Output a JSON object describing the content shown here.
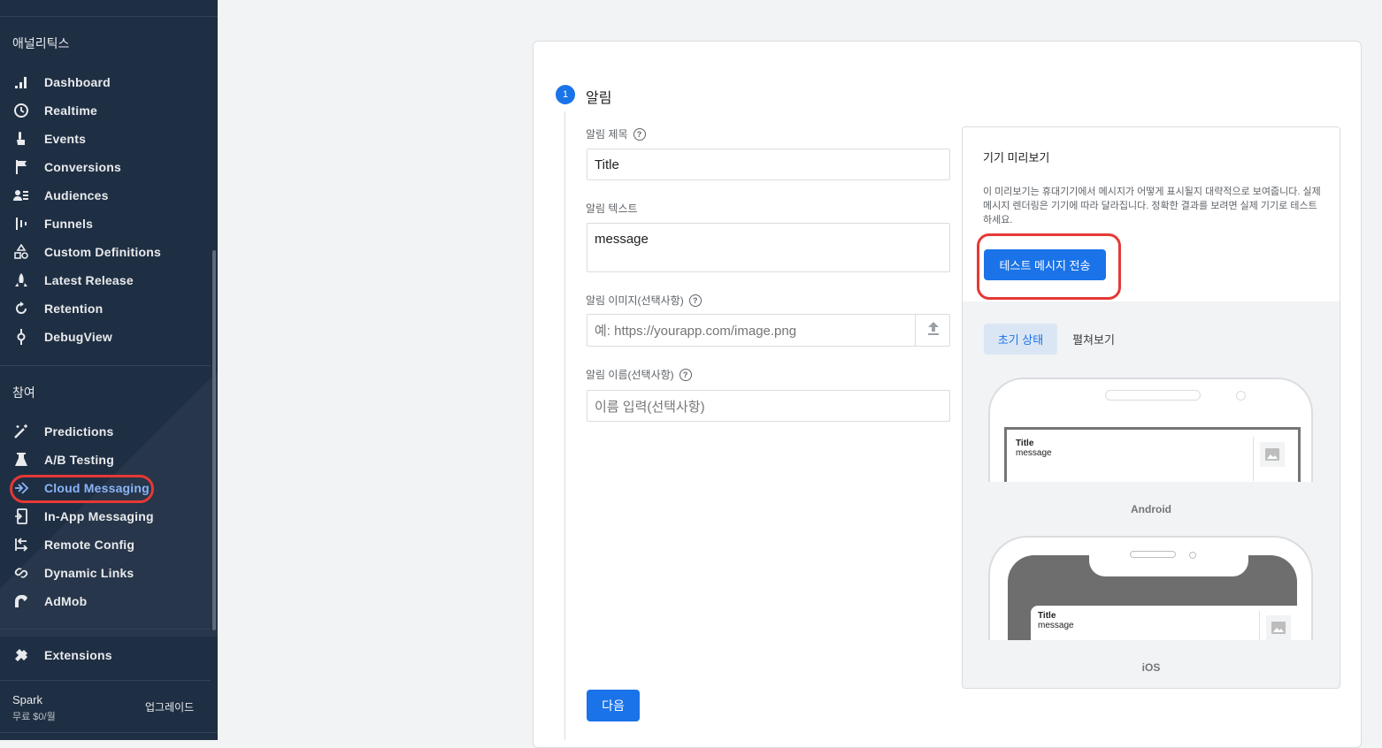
{
  "sidebar": {
    "section_analytics": "애널리틱스",
    "analytics_items": [
      {
        "label": "Dashboard",
        "icon": "bar-chart-icon"
      },
      {
        "label": "Realtime",
        "icon": "clock-icon"
      },
      {
        "label": "Events",
        "icon": "touch-icon"
      },
      {
        "label": "Conversions",
        "icon": "flag-icon"
      },
      {
        "label": "Audiences",
        "icon": "audience-icon"
      },
      {
        "label": "Funnels",
        "icon": "funnel-icon"
      },
      {
        "label": "Custom Definitions",
        "icon": "shapes-icon"
      },
      {
        "label": "Latest Release",
        "icon": "rocket-icon"
      },
      {
        "label": "Retention",
        "icon": "retention-icon"
      },
      {
        "label": "DebugView",
        "icon": "debug-icon"
      }
    ],
    "section_engage": "참여",
    "engage_items": [
      {
        "label": "Predictions",
        "icon": "magic-wand-icon"
      },
      {
        "label": "A/B Testing",
        "icon": "flask-icon"
      },
      {
        "label": "Cloud Messaging",
        "icon": "cloud-messaging-icon",
        "active": true
      },
      {
        "label": "In-App Messaging",
        "icon": "in-app-icon"
      },
      {
        "label": "Remote Config",
        "icon": "remote-config-icon"
      },
      {
        "label": "Dynamic Links",
        "icon": "link-icon"
      },
      {
        "label": "AdMob",
        "icon": "admob-icon"
      }
    ],
    "extensions": {
      "label": "Extensions",
      "icon": "extensions-icon"
    },
    "plan_name": "Spark",
    "plan_price": "무료 $0/월",
    "upgrade_label": "업그레이드"
  },
  "step": {
    "number": "1",
    "title": "알림"
  },
  "form": {
    "title_label": "알림 제목",
    "title_value": "Title",
    "text_label": "알림 텍스트",
    "text_value": "message",
    "image_label": "알림 이미지(선택사항)",
    "image_placeholder": "예: https://yourapp.com/image.png",
    "name_label": "알림 이름(선택사항)",
    "name_placeholder": "이름 입력(선택사항)",
    "next_label": "다음"
  },
  "preview": {
    "title": "기기 미리보기",
    "description": "이 미리보기는 휴대기기에서 메시지가 어떻게 표시될지 대략적으로 보여줍니다. 실제 메시지 렌더링은 기기에 따라 달라집니다. 정확한 결과를 보려면 실제 기기로 테스트하세요.",
    "send_test_label": "테스트 메시지 전송",
    "tabs": [
      "초기 상태",
      "펼쳐보기"
    ],
    "android_label": "Android",
    "ios_label": "iOS",
    "notification_title": "Title",
    "notification_message": "message"
  },
  "colors": {
    "sidebar_bg": "#1f2f43",
    "accent": "#1a73e8",
    "highlight": "#e53935"
  }
}
